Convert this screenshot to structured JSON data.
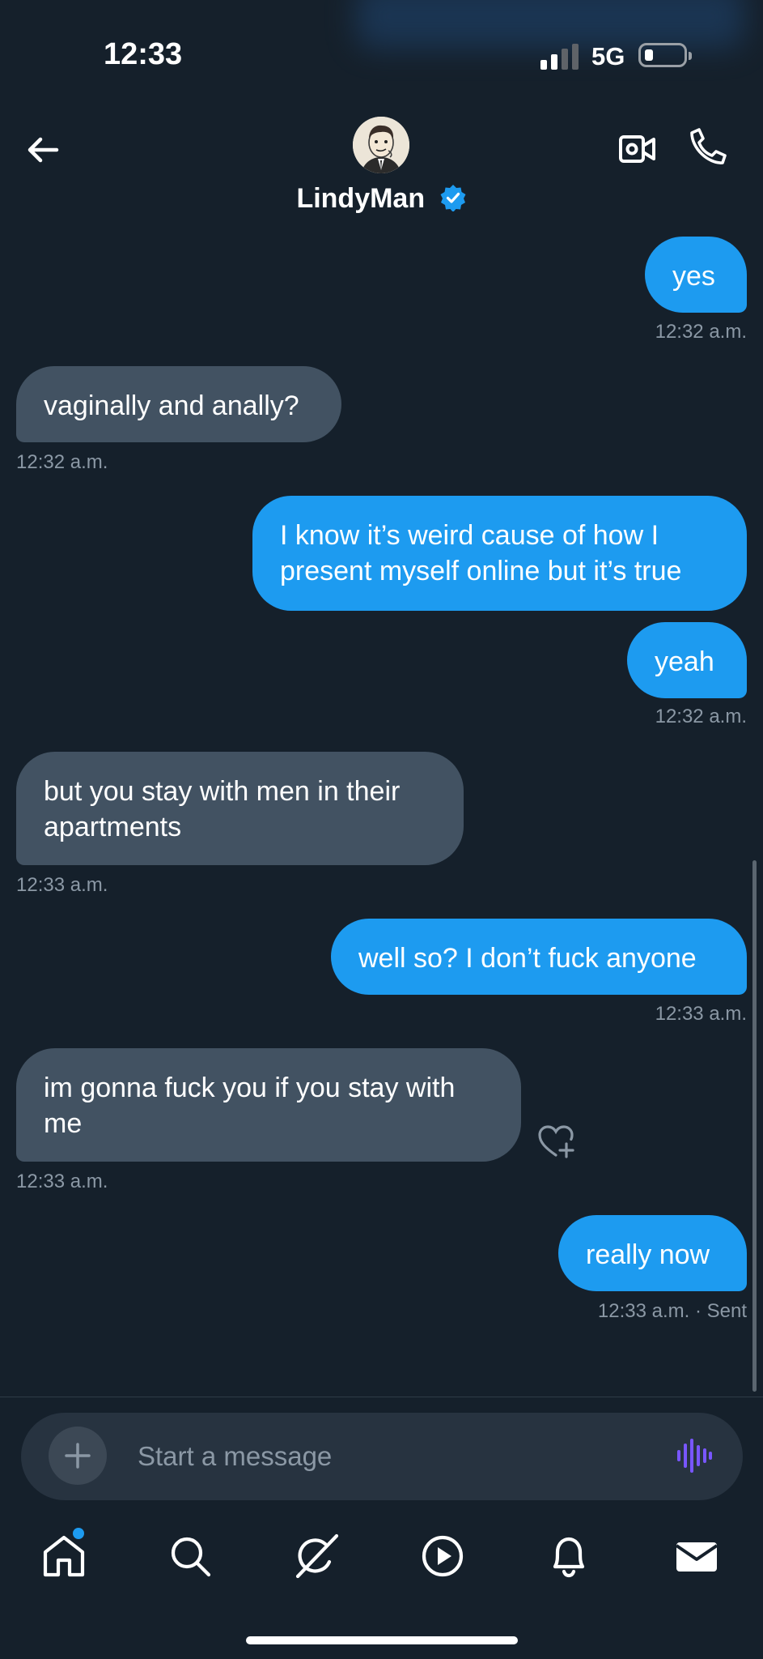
{
  "status_bar": {
    "time": "12:33",
    "network": "5G"
  },
  "header": {
    "contact_name": "LindyMan",
    "verified": true
  },
  "colors": {
    "background": "#15202b",
    "outgoing_bubble": "#1d9bf0",
    "incoming_bubble": "#425262",
    "timestamp": "#8b98a5",
    "verified_badge": "#1d9bf0"
  },
  "conversation": [
    {
      "direction": "out",
      "text": "yes",
      "timestamp": "12:32 a.m."
    },
    {
      "direction": "in",
      "text": "vaginally and anally?",
      "timestamp": "12:32 a.m."
    },
    {
      "direction": "out",
      "text": "I know it’s weird cause of how I present myself online but it’s true",
      "timestamp": ""
    },
    {
      "direction": "out",
      "text": "yeah",
      "timestamp": "12:32 a.m."
    },
    {
      "direction": "in",
      "text": "but you stay with men in their apartments",
      "timestamp": "12:33 a.m."
    },
    {
      "direction": "out",
      "text": "well so? I don’t fuck anyone",
      "timestamp": "12:33 a.m."
    },
    {
      "direction": "in",
      "text": "im gonna fuck you if you stay with me",
      "timestamp": "12:33 a.m."
    },
    {
      "direction": "out",
      "text": "really now",
      "timestamp": "12:33 a.m. · Sent"
    }
  ],
  "composer": {
    "placeholder": "Start a message"
  },
  "tab_bar": {
    "items": [
      "home-icon",
      "search-icon",
      "grok-icon",
      "video-icon",
      "notifications-icon",
      "messages-icon"
    ],
    "active": "messages-icon",
    "home_has_new": true
  }
}
